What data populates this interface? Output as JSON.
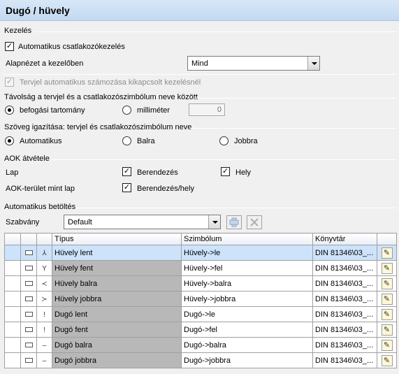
{
  "title": "Dugó / hüvely",
  "kezeles": {
    "group_label": "Kezelés",
    "auto_label": "Automatikus csatlakozókezelés",
    "auto_checked": true,
    "alap_label": "Alapnézet a kezelőben",
    "alap_value": "Mind",
    "tervjel_label": "Tervjel automatikus számozása kikapcsolt kezelésnél",
    "tervjel_checked": true
  },
  "tavolsag": {
    "group_label": "Távolság a tervjel és a csatlakozószimbólum neve között",
    "opt1": "befogási tartomány",
    "opt2": "milliméter",
    "value": "0"
  },
  "szoveg": {
    "group_label": "Szöveg igazítása: tervjel és csatlakozószimbólum neve",
    "opt1": "Automatikus",
    "opt2": "Balra",
    "opt3": "Jobbra"
  },
  "aok": {
    "group_label": "AOK átvétele",
    "lap": "Lap",
    "berendezes": "Berendezés",
    "hely": "Hely",
    "aok_terulet": "AOK-terület mint lap",
    "berendezes_hely": "Berendezés/hely"
  },
  "betoltes": {
    "group_label": "Automatikus betöltés",
    "szabvany_label": "Szabvány",
    "szabvany_value": "Default",
    "add_icon": "plus-icon",
    "remove_icon": "x-icon"
  },
  "table": {
    "headers": [
      "Típus",
      "Szimbólum",
      "Könyvtár"
    ],
    "rows": [
      {
        "tipus": "Hüvely lent",
        "szimbolum": "Hüvely->le",
        "konyvtar": "DIN 81346\\03_...",
        "glyph": "⅄"
      },
      {
        "tipus": "Hüvely fent",
        "szimbolum": "Hüvely->fel",
        "konyvtar": "DIN 81346\\03_...",
        "glyph": "Y"
      },
      {
        "tipus": "Hüvely balra",
        "szimbolum": "Hüvely->balra",
        "konyvtar": "DIN 81346\\03_...",
        "glyph": "≺"
      },
      {
        "tipus": "Hüvely jobbra",
        "szimbolum": "Hüvely->jobbra",
        "konyvtar": "DIN 81346\\03_...",
        "glyph": "≻"
      },
      {
        "tipus": "Dugó lent",
        "szimbolum": "Dugó->le",
        "konyvtar": "DIN 81346\\03_...",
        "glyph": "ǃ"
      },
      {
        "tipus": "Dugó fent",
        "szimbolum": "Dugó->fel",
        "konyvtar": "DIN 81346\\03_...",
        "glyph": "ǃ"
      },
      {
        "tipus": "Dugó balra",
        "szimbolum": "Dugó->balra",
        "konyvtar": "DIN 81346\\03_...",
        "glyph": "‒"
      },
      {
        "tipus": "Dugó jobbra",
        "szimbolum": "Dugó->jobbra",
        "konyvtar": "DIN 81346\\03_...",
        "glyph": "‒"
      }
    ]
  },
  "colors": {
    "title_bg": "#c3d9f1",
    "selected_row": "#cde3fb",
    "gray_cell": "#b8b8b8"
  }
}
